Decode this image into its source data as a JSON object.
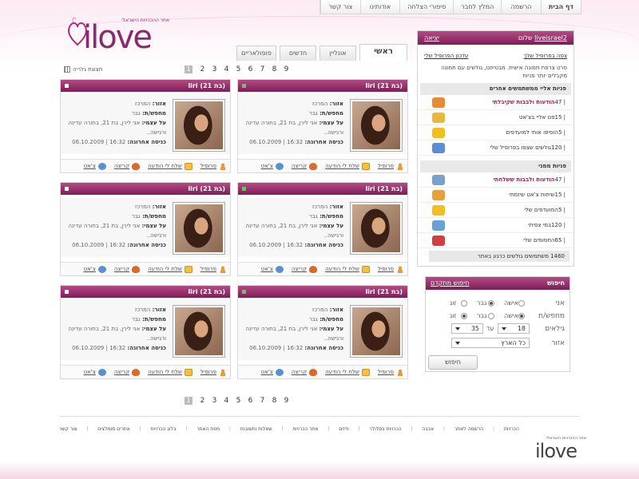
{
  "site": {
    "tagline": "אתר ההכרויות הישראלי",
    "logo_text": "ilove"
  },
  "topnav": [
    "דף הבית",
    "הרשמה",
    "המלץ לחבר",
    "סיפורי הצלחה",
    "אודותינו",
    "צור קשר"
  ],
  "tabs": [
    "ראשי",
    "אונליין",
    "חדשים",
    "פופולאריים"
  ],
  "gallery_label": "תצוגת גלריה",
  "pages": [
    "1",
    "2",
    "3",
    "4",
    "5",
    "6",
    "7",
    "8",
    "9"
  ],
  "card": {
    "title": "liri (בת 21)",
    "area_label": "אזור:",
    "area": "המרכז",
    "seek_label": "מחפש/ת:",
    "seek": "גבר",
    "about_label": "על עצמי:",
    "about": "אני לירן, בת 21, בחורה עדינה ורגישה..",
    "last_label": "כניסה אחרונה:",
    "last": "16:32 | 06.10.2009",
    "actions": [
      "פרופיל",
      "שלח לי הודעה",
      "קריצה",
      "צ'אט"
    ]
  },
  "cards_status": [
    "on",
    "off",
    "on",
    "off",
    "on",
    "off"
  ],
  "panel": {
    "greeting": "שלום",
    "username": "liveisrael2",
    "logout": "יציאה",
    "view_profile": "צפה בפרופיל שלך",
    "edit_profile": "עדכון הפרופיל שלי",
    "note": "סרט צרפת תמונה אישית. מבטיחנו, גולשים עם תמונה מקבלים יותר פניות",
    "sect1": "פניות אליי ממשתמשים אחרים",
    "rows1": [
      {
        "label": "הודעות ולבבות שקיבלתי",
        "count": "47",
        "red": true,
        "icon": "#e88a3a"
      },
      {
        "label": "פנו אליי בצ'אט",
        "count": "15",
        "red": false,
        "icon": "#e8b83a"
      },
      {
        "label": "הוסיפו אותי למועדפים",
        "count": "5",
        "red": false,
        "icon": "#f0c020"
      },
      {
        "label": "גולשים שצפו בפרופיל שלי",
        "count": "120",
        "red": false,
        "icon": "#5a8fd8"
      }
    ],
    "sect2": "פניות ממני",
    "rows2": [
      {
        "label": "הודעות ולבבות ששלחתי",
        "count": "47",
        "red": true,
        "icon": "#7aa0d0"
      },
      {
        "label": "שיחות צ'אט שיזמתי",
        "count": "15",
        "red": false,
        "icon": "#e8a03a"
      },
      {
        "label": "המועדפים שלי",
        "count": "5",
        "red": false,
        "icon": "#f0c020"
      },
      {
        "label": "במי צפיתי",
        "count": "120",
        "red": false,
        "icon": "#6aa0d8"
      },
      {
        "label": "החסומים שלי",
        "count": "65",
        "red": false,
        "icon": "#d04040"
      }
    ],
    "total": "1460 משתמשים גולשים כרגע באתר"
  },
  "search": {
    "title": "חיפוש",
    "advanced": "חיפוש מתקדם",
    "i_am": "אני",
    "seeking": "מחפש/ת",
    "ages": "גילאים",
    "area": "אזור",
    "woman": "אישה",
    "man": "גבר",
    "couple": "זוג",
    "age_from": "18",
    "age_to_label": "עד",
    "age_to": "35",
    "area_value": "כל הארץ",
    "button": "חיפוש"
  },
  "footer": [
    "הכרויות",
    "הרשמה לאתר",
    "אבבה",
    "הכרויות בסלולר",
    "פיזים",
    "אתר הכרויות",
    "שאלות ותשובות",
    "מפת האתר",
    "בלוג הכרויות",
    "אתרים מומלצים",
    "צור קשר"
  ]
}
